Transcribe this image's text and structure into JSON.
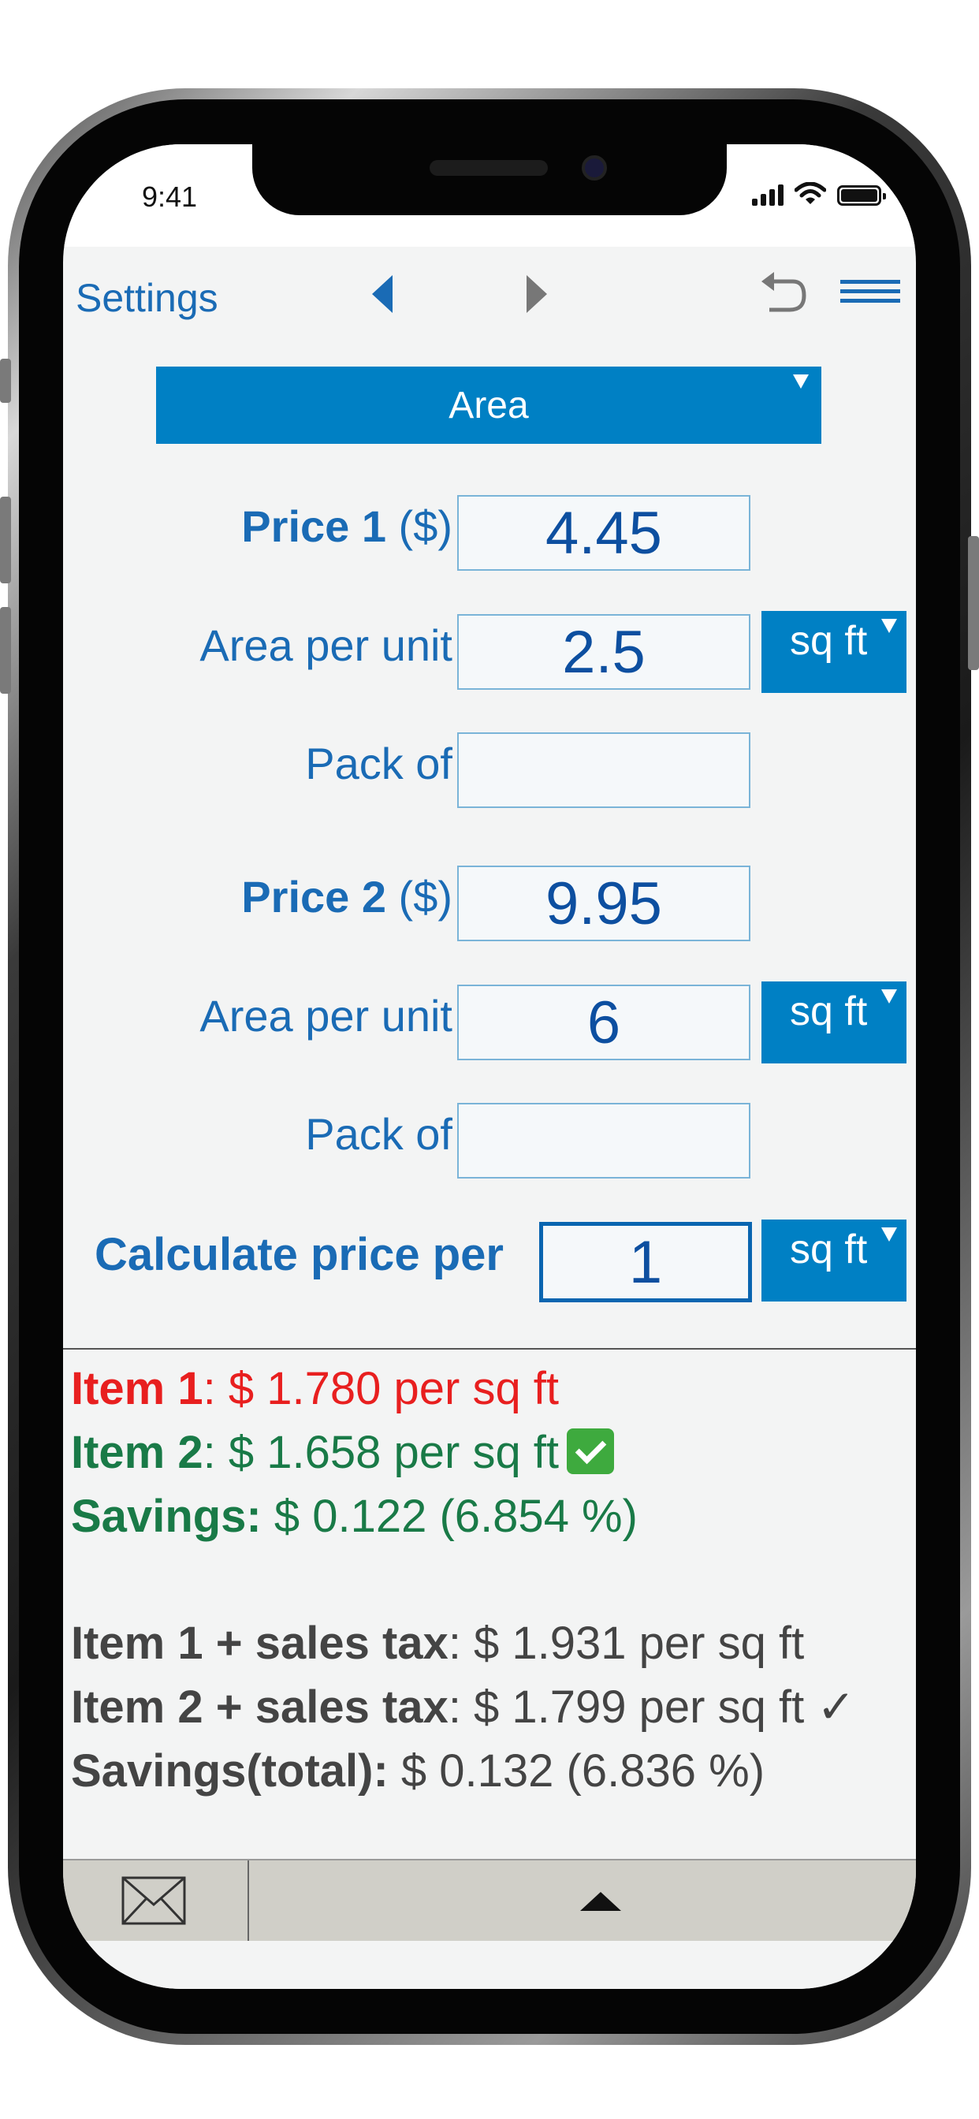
{
  "status_bar": {
    "time": "9:41"
  },
  "toolbar": {
    "settings_label": "Settings"
  },
  "category": {
    "selected": "Area"
  },
  "item1": {
    "price_label_bold": "Price 1",
    "price_label_unit": " ($)",
    "price_value": "4.45",
    "area_label": "Area per unit",
    "area_value": "2.5",
    "area_unit": "sq ft",
    "pack_label": "Pack of",
    "pack_value": ""
  },
  "item2": {
    "price_label_bold": "Price 2",
    "price_label_unit": " ($)",
    "price_value": "9.95",
    "area_label": "Area per unit",
    "area_value": "6",
    "area_unit": "sq ft",
    "pack_label": "Pack of",
    "pack_value": ""
  },
  "calc": {
    "label": "Calculate price per",
    "value": "1",
    "unit": "sq ft"
  },
  "results": {
    "item1_label": "Item 1",
    "item1_text": ": $ 1.780 per sq ft",
    "item2_label": "Item 2",
    "item2_text": ": $ 1.658 per sq ft",
    "savings_label": "Savings:",
    "savings_text": " $ 0.122 (6.854 %)",
    "tax1_label": "Item 1 + sales tax",
    "tax1_text": ": $ 1.931 per sq ft",
    "tax2_label": "Item 2 + sales tax",
    "tax2_text": ": $ 1.799 per sq ft ✓",
    "total_label": "Savings(total):",
    "total_text": " $ 0.132 (6.836 %)"
  },
  "icons": {
    "undo": "undo-icon",
    "menu": "menu-icon",
    "mail": "mail-icon",
    "expand": "up-arrow-icon",
    "best": "check-box-icon"
  },
  "colors": {
    "accent": "#0080c4",
    "link": "#1a6bb5",
    "worse": "#e81f1f",
    "better": "#197a47",
    "neutral": "#444444"
  }
}
